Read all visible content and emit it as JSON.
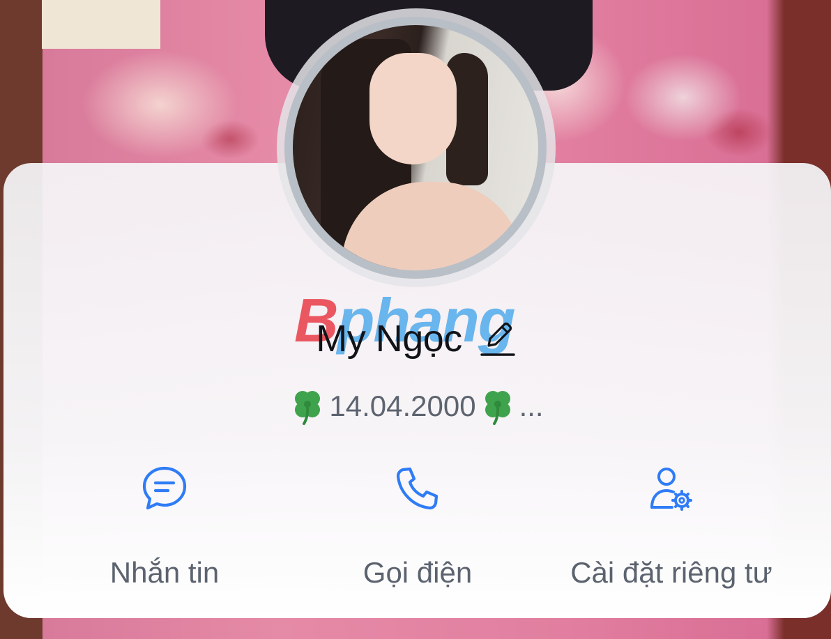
{
  "profile": {
    "name": "My Ngọc",
    "bio": {
      "emoji": "🍀",
      "text": "14.04.2000",
      "more": "..."
    }
  },
  "watermark": {
    "first": "B",
    "rest": "phang"
  },
  "actions": {
    "message_label": "Nhắn tin",
    "call_label": "Gọi điện",
    "privacy_label": "Cài đặt riêng tư"
  },
  "icons": {
    "edit": "pencil-icon",
    "message": "chat-bubble-icon",
    "call": "phone-icon",
    "privacy": "user-settings-icon"
  },
  "colors": {
    "accent": "#2f7cf6",
    "name_text": "#111318",
    "secondary_text": "#5b636e",
    "clover": "#3fa34d"
  }
}
